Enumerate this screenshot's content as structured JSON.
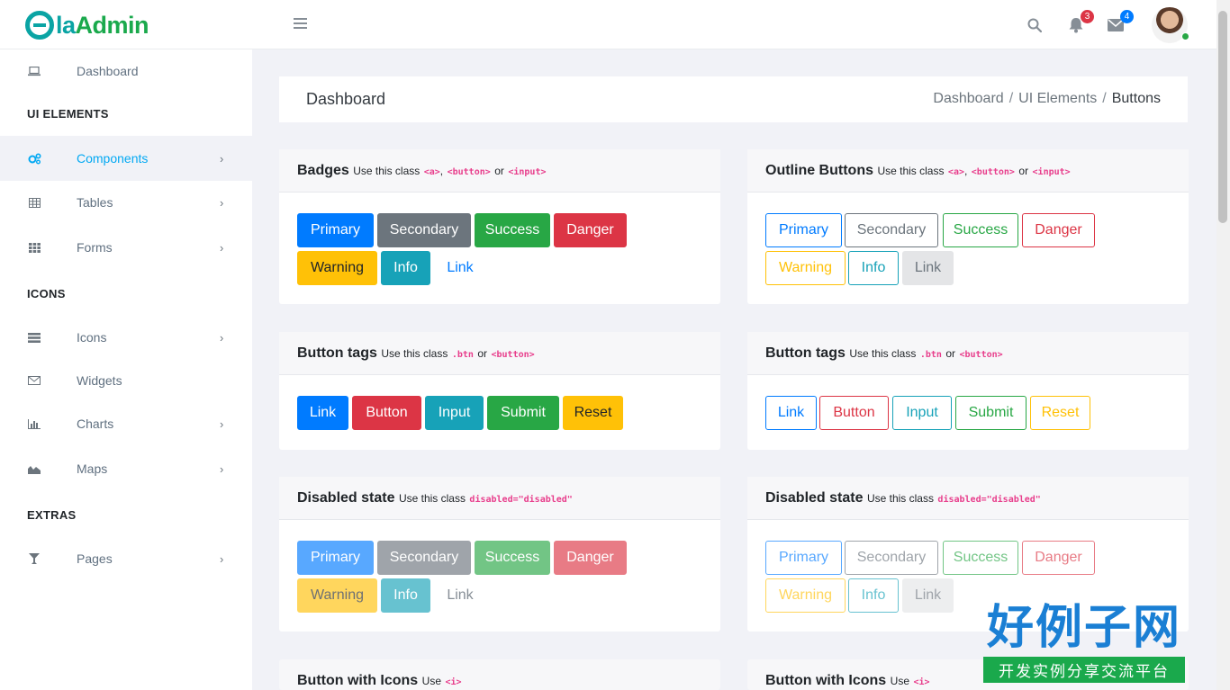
{
  "brand": {
    "logo_letter": "e",
    "name_part1": "la",
    "name_part2": "Admin"
  },
  "header": {
    "notifications_count": "3",
    "messages_count": "4",
    "colors": {
      "bell_badge": "#dc3545",
      "mail_badge": "#007bff",
      "online": "#28a745"
    }
  },
  "sidebar": {
    "items": [
      {
        "label": "Dashboard",
        "icon": "laptop-icon"
      },
      {
        "label": "Components",
        "icon": "cogs-icon"
      },
      {
        "label": "Tables",
        "icon": "table-icon"
      },
      {
        "label": "Forms",
        "icon": "th-icon"
      },
      {
        "label": "Icons",
        "icon": "tasks-icon"
      },
      {
        "label": "Widgets",
        "icon": "envelope-icon"
      },
      {
        "label": "Charts",
        "icon": "bar-chart-icon"
      },
      {
        "label": "Maps",
        "icon": "area-chart-icon"
      },
      {
        "label": "Pages",
        "icon": "glass-icon"
      }
    ],
    "sections": [
      "UI ELEMENTS",
      "ICONS",
      "EXTRAS"
    ],
    "active_color": "#03a9f3"
  },
  "breadcrumb": {
    "title": "Dashboard",
    "path": [
      "Dashboard",
      "UI Elements",
      "Buttons"
    ],
    "separator": "/"
  },
  "cards": {
    "badges": {
      "title": "Badges",
      "hint": "Use this class",
      "code": [
        "<a>",
        "<button>",
        "<input>"
      ],
      "conj": "or",
      "buttons": [
        "Primary",
        "Secondary",
        "Success",
        "Danger",
        "Warning",
        "Info",
        "Link"
      ]
    },
    "outline": {
      "title": "Outline Buttons",
      "hint": "Use this class",
      "code": [
        "<a>",
        "<button>",
        "<input>"
      ],
      "conj": "or",
      "buttons": [
        "Primary",
        "Secondary",
        "Success",
        "Danger",
        "Warning",
        "Info",
        "Link"
      ]
    },
    "tags": {
      "title": "Button tags",
      "hint": "Use this class",
      "code": [
        ".btn",
        "<button>"
      ],
      "conj": "or",
      "buttons": [
        "Link",
        "Button",
        "Input",
        "Submit",
        "Reset"
      ]
    },
    "tags_outline": {
      "title": "Button tags",
      "hint": "Use this class",
      "code": [
        ".btn",
        "<button>"
      ],
      "conj": "or",
      "buttons": [
        "Link",
        "Button",
        "Input",
        "Submit",
        "Reset"
      ]
    },
    "disabled": {
      "title": "Disabled state",
      "hint": "Use this class",
      "code": [
        "disabled=\"disabled\""
      ],
      "buttons": [
        "Primary",
        "Secondary",
        "Success",
        "Danger",
        "Warning",
        "Info",
        "Link"
      ]
    },
    "disabled_outline": {
      "title": "Disabled state",
      "hint": "Use this class",
      "code": [
        "disabled=\"disabled\""
      ],
      "buttons": [
        "Primary",
        "Secondary",
        "Success",
        "Danger",
        "Warning",
        "Info",
        "Link"
      ]
    },
    "icons": {
      "title": "Button with Icons",
      "hint": "Use",
      "code": [
        "<i>"
      ]
    },
    "icons_right": {
      "title": "Button with Icons",
      "hint": "Use",
      "code": [
        "<i>"
      ]
    }
  },
  "watermark": {
    "big": "好例子网",
    "small": "开发实例分享交流平台"
  }
}
